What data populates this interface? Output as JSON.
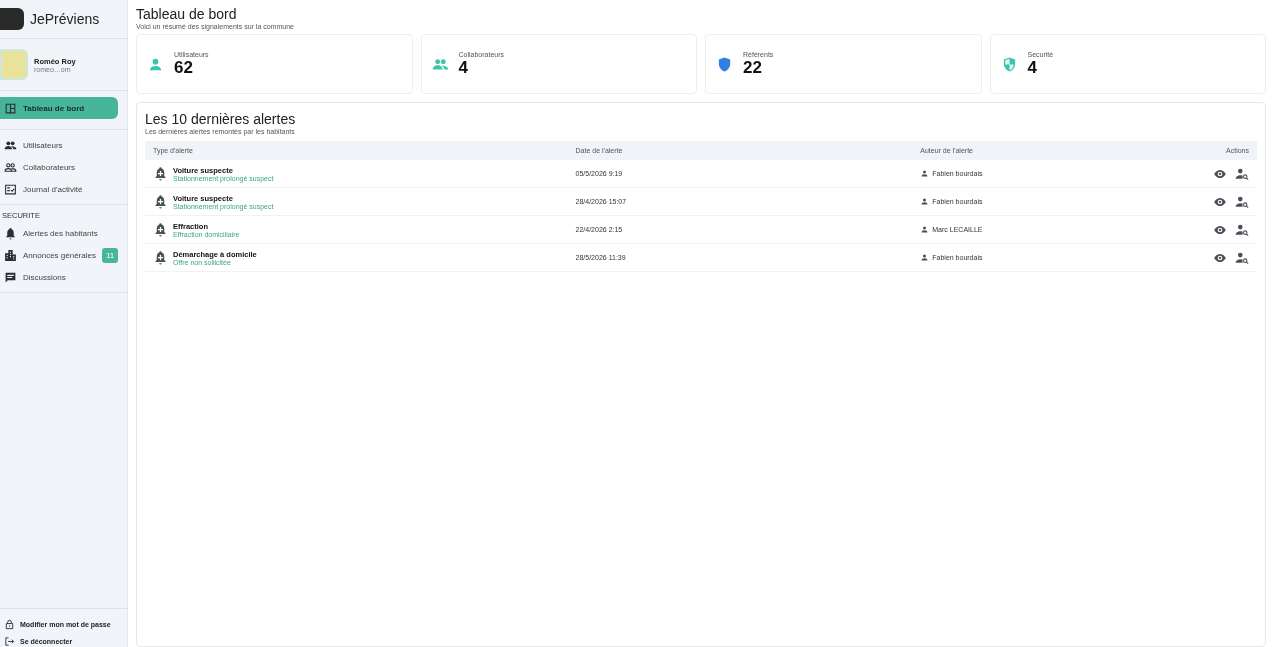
{
  "brand": {
    "name": "JePréviens"
  },
  "user": {
    "name": "Roméo Roy",
    "email": "romeo…om"
  },
  "nav": [
    {
      "kind": "item",
      "label": "Tableau de bord",
      "selected": true
    },
    {
      "kind": "divider"
    },
    {
      "kind": "item",
      "label": "Utilisateurs",
      "selected": false
    },
    {
      "kind": "item",
      "label": "Collaborateurs",
      "selected": false
    },
    {
      "kind": "item",
      "label": "Journal d'activité",
      "selected": false
    },
    {
      "kind": "divider"
    },
    {
      "kind": "section",
      "label": "SECURITE"
    },
    {
      "kind": "item",
      "label": "Alertes des habitants",
      "selected": false
    },
    {
      "kind": "item",
      "label": "Annonces générales",
      "selected": false,
      "badge": "11"
    },
    {
      "kind": "item",
      "label": "Discussions",
      "selected": false
    },
    {
      "kind": "divider"
    }
  ],
  "footer": [
    {
      "label": "Modifier mon mot de passe"
    },
    {
      "label": "Se déconnecter"
    }
  ],
  "page": {
    "title": "Tableau de bord",
    "subtitle": "Voici un résumé des signalements sur la commune"
  },
  "stats": [
    {
      "label": "Utilisateurs",
      "value": "62"
    },
    {
      "label": "Collaborateurs",
      "value": "4"
    },
    {
      "label": "Référents",
      "value": "22"
    },
    {
      "label": "Securité",
      "value": "4"
    }
  ],
  "alerts": {
    "title": "Les 10 dernières alertes",
    "subtitle": "Les dernières alertes remontés par les habitants",
    "columns": [
      "Type d'alerte",
      "Date de l'alerte",
      "Auteur de l'alerte",
      "Actions"
    ],
    "rows": [
      {
        "type": "Voiture suspecte",
        "detail": "Stationnement prolongé suspect",
        "date": "05/5/2026 9:19",
        "author": "Fabien bourdais"
      },
      {
        "type": "Voiture suspecte",
        "detail": "Stationnement prolongé suspect",
        "date": "28/4/2026 15:07",
        "author": "Fabien bourdais"
      },
      {
        "type": "Effraction",
        "detail": "Effraction domiciliaire",
        "date": "22/4/2026 2:15",
        "author": "Marc LECAILLE"
      },
      {
        "type": "Démarchage à domicile",
        "detail": "Offre non sollicitée",
        "date": "28/5/2026 11:39",
        "author": "Fabien bourdais"
      }
    ]
  }
}
